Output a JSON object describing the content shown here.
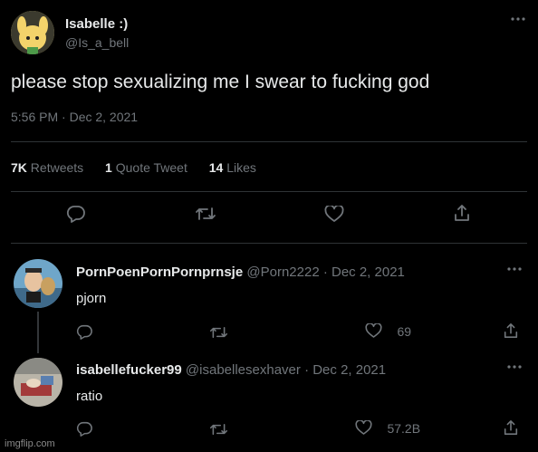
{
  "tweet": {
    "author_name": "Isabelle :)",
    "author_handle": "@Is_a_bell",
    "text": "please stop sexualizing me I swear to fucking god",
    "timestamp": "5:56 PM · Dec 2, 2021",
    "stats": {
      "retweets_count": "7K",
      "retweets_label": "Retweets",
      "quotes_count": "1",
      "quotes_label": "Quote Tweet",
      "likes_count": "14",
      "likes_label": "Likes"
    }
  },
  "replies": [
    {
      "name": "PornPoenPornPornprnsje",
      "handle": "@Porn2222",
      "date": "· Dec 2, 2021",
      "text": "pjorn",
      "like_count": "69"
    },
    {
      "name": "isabellefucker99",
      "handle": "@isabellesexhaver",
      "date": "· Dec 2, 2021",
      "text": "ratio",
      "like_count": "57.2B"
    }
  ],
  "watermark": "imgflip.com",
  "colors": {
    "background": "#000000",
    "text": "#e7e9ea",
    "muted": "#71767b",
    "divider": "#2f3336"
  },
  "icons": [
    "more-icon",
    "reply-icon",
    "retweet-icon",
    "like-icon",
    "share-icon"
  ]
}
